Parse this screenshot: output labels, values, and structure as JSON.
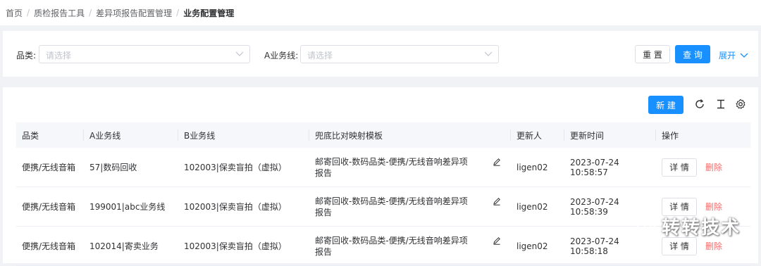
{
  "breadcrumb": {
    "items": [
      "首页",
      "质检报告工具",
      "差异项报告配置管理",
      "业务配置管理"
    ],
    "separator": "/"
  },
  "filters": {
    "category_label": "品类:",
    "category_placeholder": "请选择",
    "business_line_label": "A业务线:",
    "business_line_placeholder": "请选择",
    "reset_label": "重 置",
    "query_label": "查 询",
    "expand_label": "展开"
  },
  "toolbar": {
    "new_label": "新 建",
    "icons": [
      "refresh-icon",
      "text-height-icon",
      "settings-icon"
    ]
  },
  "table": {
    "columns": [
      "品类",
      "A业务线",
      "B业务线",
      "兜底比对映射模板",
      "更新人",
      "更新时间",
      "操作"
    ],
    "rows": [
      {
        "category": "便携/无线音箱",
        "a_line": "57|数码回收",
        "b_line": "102003|保卖盲拍（虚拟）",
        "template": "邮寄回收-数码品类-便携/无线音响差异项报告",
        "updater": "ligen02",
        "updated_at": "2023-07-24 10:58:57",
        "detail_label": "详 情",
        "delete_label": "删除"
      },
      {
        "category": "便携/无线音箱",
        "a_line": "199001|abc业务线",
        "b_line": "102003|保卖盲拍（虚拟）",
        "template": "邮寄回收-数码品类-便携/无线音响差异项报告",
        "updater": "ligen02",
        "updated_at": "2023-07-24 10:58:39",
        "detail_label": "详 情",
        "delete_label": "删除"
      },
      {
        "category": "便携/无线音箱",
        "a_line": "102014|寄卖业务",
        "b_line": "102003|保卖盲拍（虚拟）",
        "template": "邮寄回收-数码品类-便携/无线音响差异项报告",
        "updater": "ligen02",
        "updated_at": "2023-07-24 10:58:18",
        "detail_label": "详 情",
        "delete_label": "删除"
      }
    ]
  },
  "watermark": {
    "text": "转转技术"
  },
  "colors": {
    "primary": "#1890ff",
    "danger": "#f56c6c",
    "border": "#dcdfe6",
    "header_bg": "#f5f7fa"
  }
}
